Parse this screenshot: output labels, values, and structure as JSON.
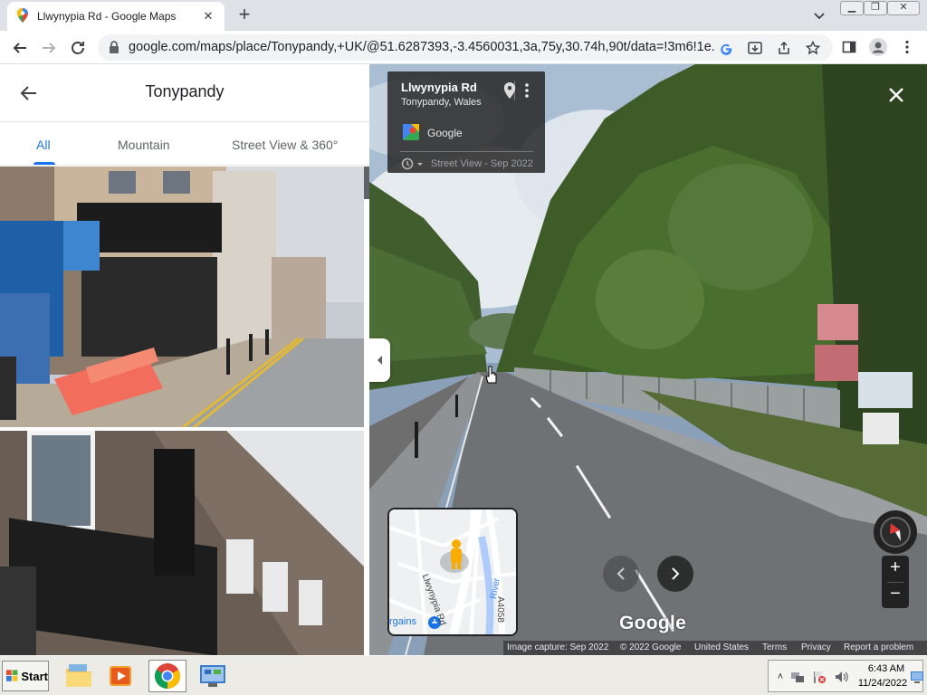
{
  "browser": {
    "tab_title": "Llwynypia Rd - Google Maps",
    "url": "google.com/maps/place/Tonypandy,+UK/@51.6287393,-3.4560031,3a,75y,30.74h,90t/data=!3m6!1e..."
  },
  "sidepanel": {
    "title": "Tonypandy",
    "tabs": [
      {
        "label": "All",
        "active": true
      },
      {
        "label": "Mountain",
        "active": false
      },
      {
        "label": "Street View & 360°",
        "active": false
      }
    ]
  },
  "streetview": {
    "road_name": "Llwynypia Rd",
    "place": "Tonypandy, Wales",
    "contributor": "Google",
    "time_label": "Street View - Sep 2022",
    "logo": "Google",
    "minimap": {
      "road_label": "Llwynypia Rd",
      "road_label_2": "A4058",
      "river_label": "River",
      "poi_label": "rgains"
    },
    "footer": {
      "capture": "Image capture: Sep 2022",
      "copyright": "© 2022 Google",
      "country": "United States",
      "terms": "Terms",
      "privacy": "Privacy",
      "report": "Report a problem"
    }
  },
  "taskbar": {
    "start_label": "Start",
    "time": "6:43 AM",
    "date": "11/24/2022"
  },
  "colors": {
    "accent": "#1a73e8",
    "tabstrip": "#dee1e6",
    "card_bg": "#282828"
  }
}
